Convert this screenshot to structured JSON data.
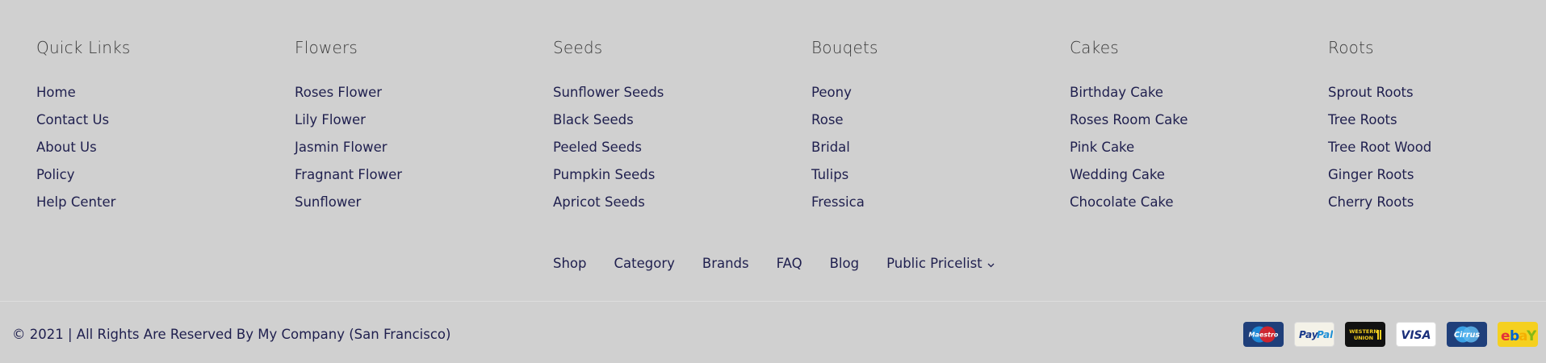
{
  "columns": [
    {
      "title": "Quick Links",
      "items": [
        "Home",
        "Contact Us",
        "About Us",
        "Policy",
        "Help Center"
      ]
    },
    {
      "title": "Flowers",
      "items": [
        "Roses Flower",
        "Lily Flower",
        "Jasmin Flower",
        "Fragnant Flower",
        "Sunflower"
      ]
    },
    {
      "title": "Seeds",
      "items": [
        "Sunflower Seeds",
        "Black Seeds",
        "Peeled Seeds",
        "Pumpkin Seeds",
        "Apricot Seeds"
      ]
    },
    {
      "title": "Bouqets",
      "items": [
        "Peony",
        "Rose",
        "Bridal",
        "Tulips",
        "Fressica"
      ]
    },
    {
      "title": "Cakes",
      "items": [
        "Birthday Cake",
        "Roses Room Cake",
        "Pink Cake",
        "Wedding Cake",
        "Chocolate Cake"
      ]
    },
    {
      "title": "Roots",
      "items": [
        "Sprout Roots",
        "Tree Roots",
        "Tree Root Wood",
        "Ginger Roots",
        "Cherry Roots"
      ]
    }
  ],
  "bottom_nav": {
    "links": [
      "Shop",
      "Category",
      "Brands",
      "FAQ",
      "Blog"
    ],
    "pricelist_label": "Public Pricelist",
    "pricelist_icon": "chevron-down-icon"
  },
  "copyright": "© 2021 | All Rights Are Reserved By My Company (San Francisco)",
  "payments": {
    "maestro": "Maestro",
    "paypal_pay": "Pay",
    "paypal_pal": "Pal",
    "western_union_line1": "WESTERN",
    "western_union_line2": "UNION",
    "visa": "VISA",
    "cirrus": "Cirrus",
    "ebay_e": "e",
    "ebay_b": "b",
    "ebay_a": "a",
    "ebay_y": "Y"
  },
  "colors": {
    "background": "#d0d0d0",
    "link_text": "#1f1f4e",
    "title_text": "#3a3a3a",
    "divider": "#dedede"
  }
}
